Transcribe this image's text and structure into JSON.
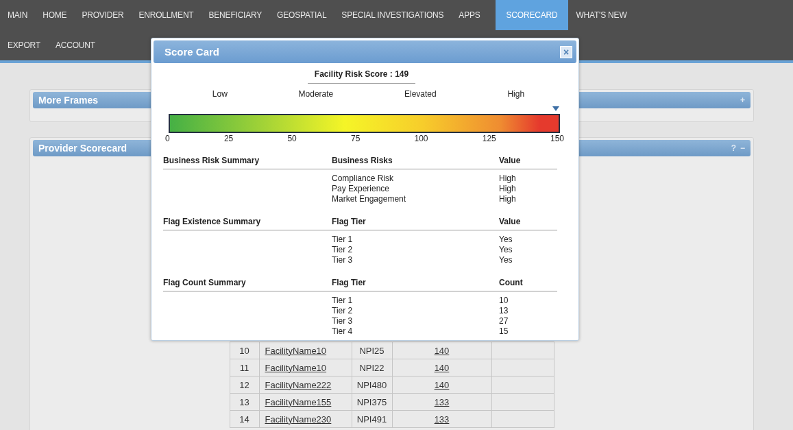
{
  "nav": {
    "rows": [
      [
        {
          "label": "MAIN",
          "selected": false
        },
        {
          "label": "HOME",
          "selected": false
        },
        {
          "label": "PROVIDER",
          "selected": false
        },
        {
          "label": "ENROLLMENT",
          "selected": false
        },
        {
          "label": "BENEFICIARY",
          "selected": false
        },
        {
          "label": "GEOSPATIAL",
          "selected": false
        },
        {
          "label": "SPECIAL INVESTIGATIONS",
          "selected": false
        },
        {
          "label": "APPS",
          "selected": false
        },
        {
          "label": "SCORECARD",
          "selected": true
        },
        {
          "label": "WHAT'S NEW",
          "selected": false
        }
      ],
      [
        {
          "label": "EXPORT",
          "selected": false
        },
        {
          "label": "ACCOUNT",
          "selected": false
        }
      ]
    ]
  },
  "panels": [
    {
      "title": "More Frames",
      "controls": [
        "+"
      ]
    },
    {
      "title": "Provider Scorecard",
      "controls": [
        "?",
        "−"
      ]
    }
  ],
  "table": {
    "rows": [
      {
        "rank": "10",
        "facility": "FacilityName10",
        "npi": "NPI25",
        "score": "140"
      },
      {
        "rank": "11",
        "facility": "FacilityName10",
        "npi": "NPI22",
        "score": "140"
      },
      {
        "rank": "12",
        "facility": "FacilityName222",
        "npi": "NPI480",
        "score": "140"
      },
      {
        "rank": "13",
        "facility": "FacilityName155",
        "npi": "NPI375",
        "score": "133"
      },
      {
        "rank": "14",
        "facility": "FacilityName230",
        "npi": "NPI491",
        "score": "133"
      }
    ]
  },
  "dialog": {
    "title": "Score Card",
    "close": "×",
    "score_title": "Facility Risk Score : 149",
    "scale": {
      "bands": [
        "Low",
        "Moderate",
        "Elevated",
        "High"
      ],
      "ticks": [
        "0",
        "25",
        "50",
        "75",
        "100",
        "125",
        "150"
      ],
      "level": 0.993
    },
    "sections": [
      {
        "heading": "Business Risk Summary",
        "column_header": "Business Risks",
        "value_header": "Value",
        "rows": [
          {
            "name": "Compliance Risk",
            "value": "High"
          },
          {
            "name": "Pay Experience",
            "value": "High"
          },
          {
            "name": "Market Engagement",
            "value": "High"
          }
        ]
      },
      {
        "heading": "Flag Existence Summary",
        "column_header": "Flag Tier",
        "value_header": "Value",
        "rows": [
          {
            "name": "Tier 1",
            "value": "Yes"
          },
          {
            "name": "Tier 2",
            "value": "Yes"
          },
          {
            "name": "Tier 3",
            "value": "Yes"
          }
        ]
      },
      {
        "heading": "Flag Count Summary",
        "column_header": "Flag Tier",
        "value_header": "Count",
        "rows": [
          {
            "name": "Tier 1",
            "value": "10"
          },
          {
            "name": "Tier 2",
            "value": "13"
          },
          {
            "name": "Tier 3",
            "value": "27"
          },
          {
            "name": "Tier 4",
            "value": "15"
          }
        ]
      }
    ]
  }
}
